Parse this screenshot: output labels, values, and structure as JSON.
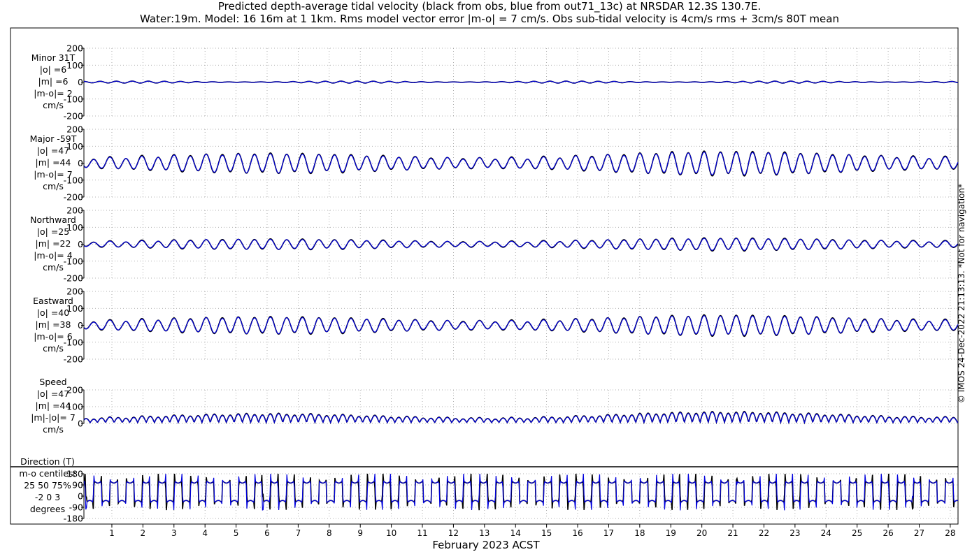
{
  "title_line1": "Predicted depth-average tidal velocity (black from obs, blue from out71_13c) at NRSDAR 12.3S 130.7E.",
  "title_line2": "Water:19m. Model: 16 16m at 1 1km. Rms model vector error |m-o| = 7 cm/s. Obs sub-tidal velocity is 4cm/s rms + 3cm/s 80T mean",
  "credit": "© IMOS 24-Dec-2022 21:13:13. *Not for navigation*",
  "xlabel": "February 2023 ACST",
  "colors": {
    "obs": "#000000",
    "model": "#0000dd",
    "grid": "#999999"
  },
  "chart_data": {
    "type": "line",
    "x_days": {
      "min": 0.1,
      "max": 28.25
    },
    "x_ticks": [
      "1",
      "2",
      "3",
      "4",
      "5",
      "6",
      "7",
      "8",
      "9",
      "10",
      "11",
      "12",
      "13",
      "14",
      "15",
      "16",
      "17",
      "18",
      "19",
      "20",
      "21",
      "22",
      "23",
      "24",
      "25",
      "26",
      "27",
      "28"
    ],
    "panels": [
      {
        "id": "minor",
        "label": [
          "Minor 31T",
          "|o| =6",
          "|m| =6",
          "|m-o|= 2",
          "cm/s"
        ],
        "ylim": [
          -200,
          200
        ],
        "yticks": [
          "200",
          "100",
          "0",
          "-100",
          "-200"
        ],
        "amplitude": 6,
        "signal": "minor"
      },
      {
        "id": "major",
        "label": [
          "Major -59T",
          "|o| =47",
          "|m| =44",
          "|m-o|= 7",
          "cm/s"
        ],
        "ylim": [
          -200,
          200
        ],
        "yticks": [
          "200",
          "100",
          "0",
          "-100",
          "-200"
        ],
        "amplitude": 1.0,
        "signal": "major"
      },
      {
        "id": "north",
        "label": [
          "Northward",
          "|o| =25",
          "|m| =22",
          "|m-o|= 4",
          "cm/s"
        ],
        "ylim": [
          -200,
          200
        ],
        "yticks": [
          "200",
          "100",
          "0",
          "-100",
          "-200"
        ],
        "amplitude": 0.52,
        "signal": "major"
      },
      {
        "id": "east",
        "label": [
          "Eastward",
          "|o| =40",
          "|m| =38",
          "|m-o|= 6",
          "cm/s"
        ],
        "ylim": [
          -200,
          200
        ],
        "yticks": [
          "200",
          "100",
          "0",
          "-100",
          "-200"
        ],
        "amplitude": 0.86,
        "signal": "major"
      },
      {
        "id": "speed",
        "label": [
          "Speed",
          "|o| =47",
          "|m| =44",
          "|m|-|o|= 7",
          "cm/s"
        ],
        "ylim": [
          0,
          200
        ],
        "yticks": [
          "200",
          "100",
          "0"
        ],
        "amplitude": 1.0,
        "signal": "speed"
      },
      {
        "id": "direction",
        "label": [
          "Direction (T)",
          "m-o centiles:",
          "25  50  75%",
          "-2  0  3",
          "degrees"
        ],
        "ylim": [
          -180,
          180
        ],
        "yticks": [
          "180",
          "90",
          "0",
          "-90",
          "-180"
        ],
        "amplitude": 1.0,
        "signal": "direction"
      }
    ]
  }
}
